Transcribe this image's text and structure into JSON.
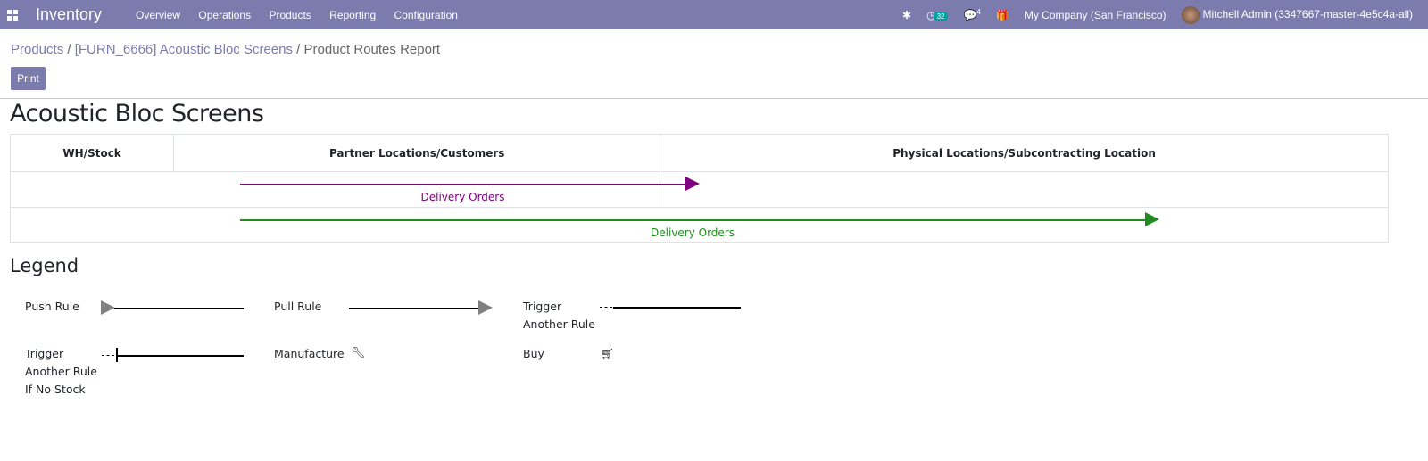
{
  "navbar": {
    "app_name": "Inventory",
    "menu": [
      "Overview",
      "Operations",
      "Products",
      "Reporting",
      "Configuration"
    ],
    "activity_count": "32",
    "messages_count": "4",
    "company": "My Company (San Francisco)",
    "user": "Mitchell Admin (3347667-master-4e5c4a-all)",
    "color": "#7c7bad"
  },
  "breadcrumb": {
    "items": [
      "Products",
      "[FURN_6666] Acoustic Bloc Screens"
    ],
    "current": "Product Routes Report"
  },
  "print_label": "Print",
  "report": {
    "title": "Acoustic Bloc Screens",
    "columns": [
      "WH/Stock",
      "Partner Locations/Customers",
      "Physical Locations/Subcontracting Location"
    ],
    "routes": [
      {
        "label": "Delivery Orders",
        "from": "WH/Stock",
        "to": "Partner Locations/Customers",
        "color": "#800080"
      },
      {
        "label": "Delivery Orders",
        "from": "WH/Stock",
        "to": "Physical Locations/Subcontracting Location",
        "color": "#228b22"
      }
    ]
  },
  "legend": {
    "title": "Legend",
    "items": [
      "Push Rule",
      "Pull Rule",
      "Trigger Another Rule",
      "Trigger Another Rule If No Stock",
      "Manufacture",
      "Buy"
    ],
    "trigger_lines": [
      "Trigger",
      "Another Rule"
    ],
    "trigger_nostock_lines": [
      "Trigger",
      "Another Rule",
      "If No Stock"
    ]
  }
}
